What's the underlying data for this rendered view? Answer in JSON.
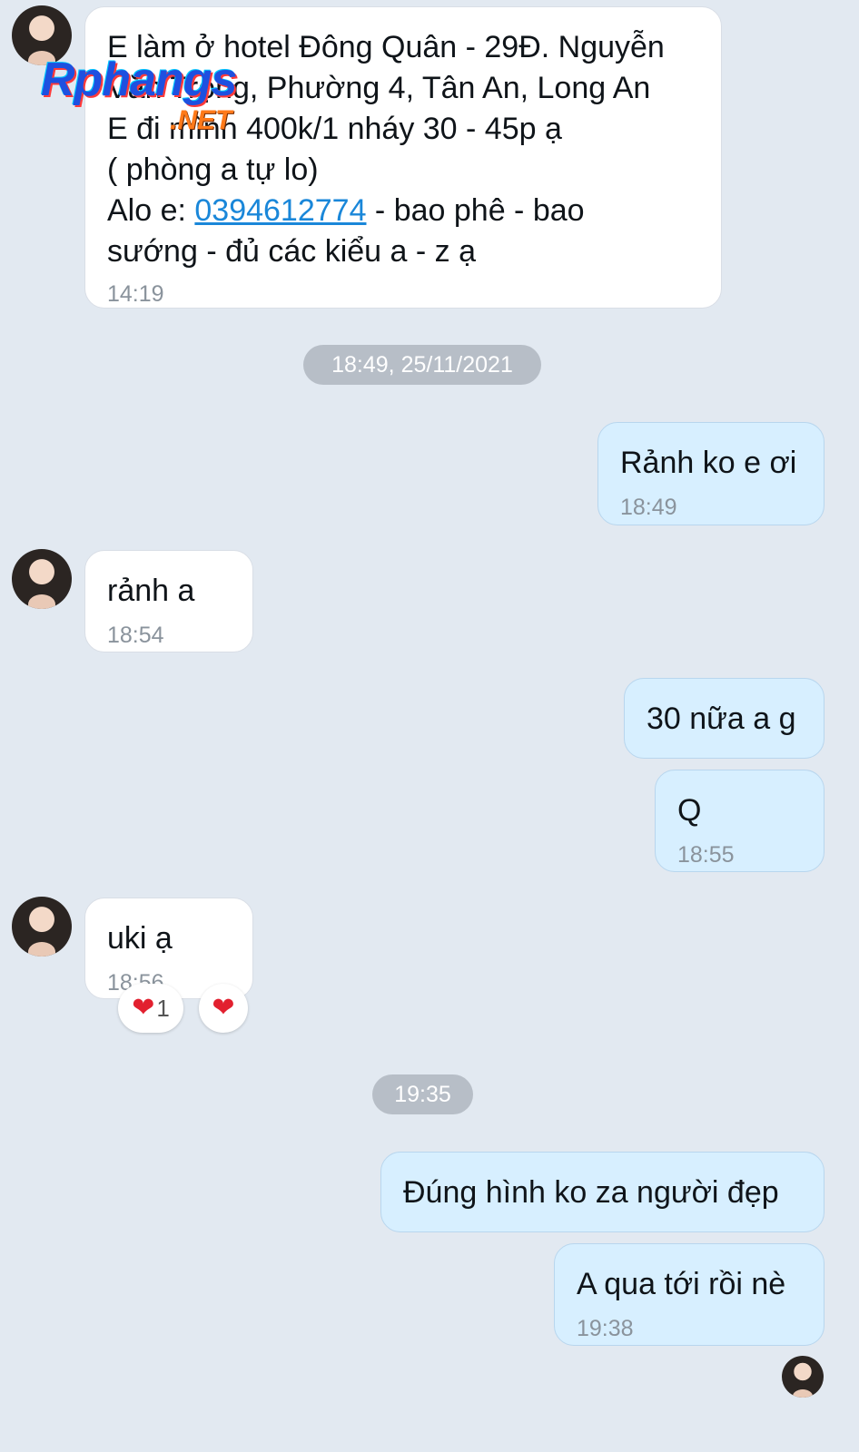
{
  "watermark": {
    "brand": "Rphangs",
    "suffix": ".NET"
  },
  "messages": {
    "m1": {
      "line1": "E làm ở hotel Đông Quân - 29Đ. Nguyễn",
      "line2": "Văn Trọng, Phường 4, Tân An, Long An",
      "line3": "E đi mình 400k/1 nháy 30 - 45p ạ",
      "line4": "( phòng a tự lo)",
      "line5_prefix": "Alo e: ",
      "phone": "0394612774",
      "line5_suffix": " - bao phê - bao",
      "line6": "sướng - đủ các kiểu a - z ạ",
      "time": "14:19"
    },
    "date1": "18:49, 25/11/2021",
    "m2": {
      "text": "Rảnh ko e ơi",
      "time": "18:49"
    },
    "m3": {
      "text": "rảnh a",
      "time": "18:54"
    },
    "m4": {
      "text": "30 nữa a g"
    },
    "m5": {
      "text": "Q",
      "time": "18:55"
    },
    "m6": {
      "text": "uki ạ",
      "time": "18:56",
      "reaction_summary": {
        "icon": "heart",
        "count": "1"
      },
      "reaction_button": {
        "icon": "heart"
      }
    },
    "date2": "19:35",
    "m7": {
      "text": "Đúng hình ko za người đẹp"
    },
    "m8": {
      "text": "A qua tới rồi nè",
      "time": "19:38"
    }
  },
  "colors": {
    "background": "#e2e9f1",
    "incoming_bubble": "#ffffff",
    "outgoing_bubble": "#d7efff",
    "link": "#1a87d9",
    "heart": "#e2202f"
  }
}
